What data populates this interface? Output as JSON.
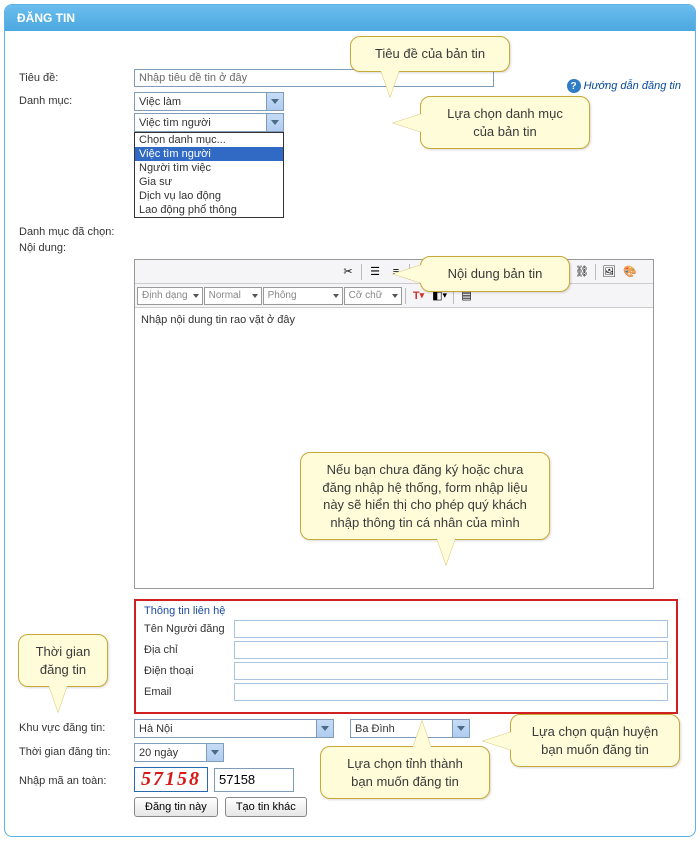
{
  "panel": {
    "title": "ĐĂNG TIN"
  },
  "help": {
    "label": "Hướng dẫn đăng tin"
  },
  "fields": {
    "title_label": "Tiêu đề:",
    "title_placeholder": "Nhập tiêu đề tin ở đây",
    "category_label": "Danh mục:",
    "category1_value": "Việc làm",
    "category2_value": "Việc tìm người",
    "dropdown": {
      "items": [
        "Chọn danh mục...",
        "Việc tìm người",
        "Người tìm việc",
        "Gia sư",
        "Dịch vụ lao động",
        "Lao động phổ thông"
      ],
      "selected": "Việc tìm người"
    },
    "selected_category_label": "Danh mục đã chọn:",
    "content_label": "Nội dung:",
    "content_placeholder": "Nhập nội dung tin rao vặt ở đây"
  },
  "toolbar": {
    "format_combo": "Định dạng",
    "normal_combo": "Normal",
    "font_combo": "Phông",
    "size_combo": "Cỡ chữ"
  },
  "contact": {
    "legend": "Thông tin liên hệ",
    "name_label": "Tên Người đăng",
    "address_label": "Địa chỉ",
    "phone_label": "Điện thoại",
    "email_label": "Email"
  },
  "region": {
    "label": "Khu vực đăng tin:",
    "province_value": "Hà Nội",
    "district_value": "Ba Đình"
  },
  "duration": {
    "label": "Thời gian đăng tin:",
    "value": "20 ngày"
  },
  "captcha": {
    "label": "Nhập mã an toàn:",
    "image_code": "57158",
    "input_value": "57158"
  },
  "buttons": {
    "submit": "Đăng tin này",
    "reset": "Tạo tin khác"
  },
  "callouts": {
    "title": "Tiêu đề của bản tin",
    "category": "Lựa chọn danh mục của bản tin",
    "content": "Nội dung bản tin",
    "contact": "Nếu bạn chưa đăng ký hoặc chưa đăng nhập hệ thống, form nhập liệu này sẽ hiển thị cho phép quý khách nhập thông tin cá nhân của mình",
    "duration": "Thời gian đăng tin",
    "province": "Lựa chọn tỉnh thành bạn muốn đăng tin",
    "district": "Lựa chọn quận huyện bạn muốn đăng tin"
  }
}
